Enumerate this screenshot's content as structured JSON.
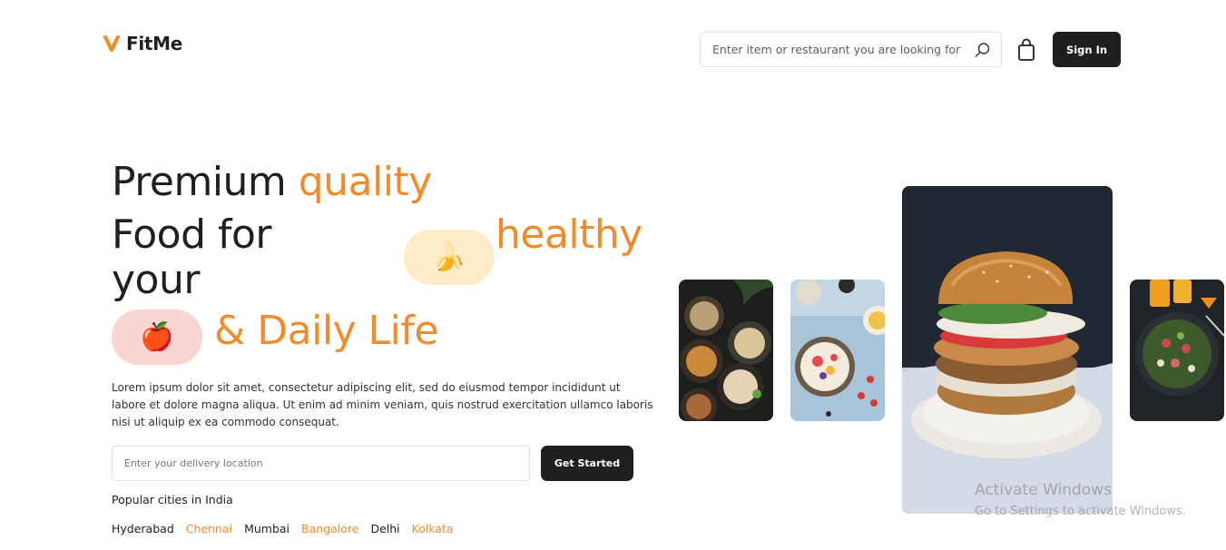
{
  "header": {
    "logo_text": "FitMe",
    "search_placeholder": "Enter item or restaurant you are looking for",
    "signin_label": "Sign In"
  },
  "hero": {
    "line1_dark": "Premium",
    "line1_orange": "quality",
    "line2_dark": "Food for",
    "line2_orange": "healthy",
    "line3_dark": "your",
    "line4_orange": "& Daily Life",
    "banana_emoji": "🍌",
    "apple_emoji": "🍎",
    "description": "Lorem ipsum dolor sit amet, consectetur adipiscing elit, sed do eiusmod tempor incididunt ut labore et dolore magna aliqua. Ut enim ad minim veniam, quis nostrud exercitation ullamco laboris nisi ut aliquip ex ea commodo consequat.",
    "location_placeholder": "Enter your delivery location",
    "cta_label": "Get Started"
  },
  "cities": {
    "title": "Popular cities in India",
    "items": [
      "Hyderabad",
      "Chennai",
      "Mumbai",
      "Bangalore",
      "Delhi",
      "Kolkata"
    ]
  },
  "watermark": {
    "title": "Activate Windows",
    "subtitle": "Go to Settings to activate Windows."
  },
  "colors": {
    "accent": "#f08c2a",
    "dark": "#1f1f1f",
    "banana_pill": "#fdebc9",
    "apple_pill": "#fbd4d4"
  },
  "icons": {
    "logo": "fitme-logo-icon",
    "search": "search-icon",
    "cart": "shopping-bag-icon"
  }
}
